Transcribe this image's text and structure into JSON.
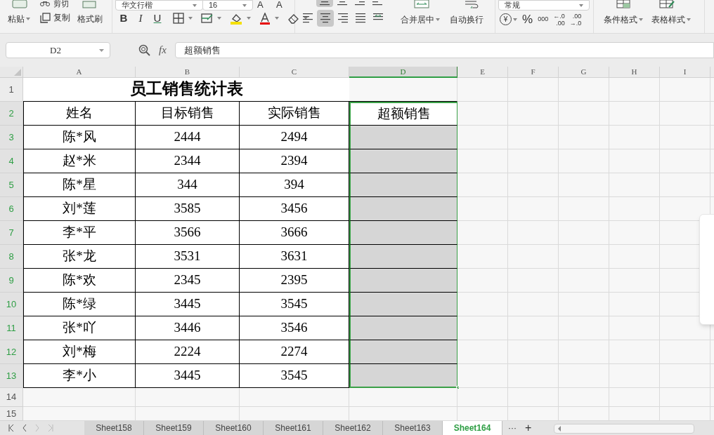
{
  "ribbon": {
    "clipboard": {
      "cut": "剪切",
      "paste": "粘贴",
      "copy": "复制",
      "format_painter": "格式刷"
    },
    "font": {
      "name": "华文行楷",
      "size": "16",
      "size_buttons": [
        "A",
        "A"
      ],
      "style_buttons": [
        "B",
        "I",
        "U"
      ]
    },
    "alignment": {
      "top_row": [
        {
          "kind": "align-middle",
          "selected": true
        },
        {
          "kind": "align-bottom",
          "selected": false
        },
        {
          "kind": "indent-less",
          "selected": false
        },
        {
          "kind": "indent-more",
          "selected": false
        }
      ],
      "bottom_row": [
        {
          "kind": "align-left",
          "selected": false
        },
        {
          "kind": "align-center",
          "selected": true
        },
        {
          "kind": "align-right",
          "selected": false
        },
        {
          "kind": "justify",
          "selected": false
        },
        {
          "kind": "distribute",
          "selected": false
        }
      ],
      "merge": "合并居中",
      "wrap": "自动换行"
    },
    "number": {
      "format": "常规",
      "currency": "¥",
      "percent": "%",
      "thousands": "000",
      "decimals": [
        {
          "top": "←.0",
          "bottom": ".00"
        },
        {
          "top": ".00",
          "bottom": "→.0"
        }
      ]
    },
    "styles": [
      "条件格式",
      "表格样式"
    ]
  },
  "formula_bar": {
    "cell_ref": "D2",
    "fx": "fx",
    "formula": "超额销售"
  },
  "column_headers": [
    {
      "label": "A",
      "selected": false
    },
    {
      "label": "B",
      "selected": false
    },
    {
      "label": "C",
      "selected": false
    },
    {
      "label": "D",
      "selected": true
    },
    {
      "label": "E",
      "selected": false
    },
    {
      "label": "F",
      "selected": false
    },
    {
      "label": "G",
      "selected": false
    },
    {
      "label": "H",
      "selected": false
    },
    {
      "label": "I",
      "selected": false
    }
  ],
  "row_headers": [
    {
      "label": "1",
      "selected": false
    },
    {
      "label": "2",
      "selected": true
    },
    {
      "label": "3",
      "selected": true
    },
    {
      "label": "4",
      "selected": true
    },
    {
      "label": "5",
      "selected": true
    },
    {
      "label": "6",
      "selected": true
    },
    {
      "label": "7",
      "selected": true
    },
    {
      "label": "8",
      "selected": true
    },
    {
      "label": "9",
      "selected": true
    },
    {
      "label": "10",
      "selected": true
    },
    {
      "label": "11",
      "selected": true
    },
    {
      "label": "12",
      "selected": true
    },
    {
      "label": "13",
      "selected": true
    },
    {
      "label": "14",
      "selected": false
    },
    {
      "label": "15",
      "selected": false
    }
  ],
  "sheet": {
    "title": "员工销售统计表",
    "columns": [
      "姓名",
      "目标销售",
      "实际销售",
      "超额销售"
    ],
    "rows": [
      [
        "陈*风",
        "2444",
        "2494"
      ],
      [
        "赵*米",
        "2344",
        "2394"
      ],
      [
        "陈*星",
        "344",
        "394"
      ],
      [
        "刘*莲",
        "3585",
        "3456"
      ],
      [
        "李*平",
        "3566",
        "3666"
      ],
      [
        "张*龙",
        "3531",
        "3631"
      ],
      [
        "陈*欢",
        "2345",
        "2395"
      ],
      [
        "陈*绿",
        "3445",
        "3545"
      ],
      [
        "张*吖",
        "3446",
        "3546"
      ],
      [
        "刘*梅",
        "2224",
        "2274"
      ],
      [
        "李*小",
        "3445",
        "3545"
      ]
    ]
  },
  "sheet_tabs": [
    {
      "label": "Sheet158",
      "selected": false
    },
    {
      "label": "Sheet159",
      "selected": false
    },
    {
      "label": "Sheet160",
      "selected": false
    },
    {
      "label": "Sheet161",
      "selected": false
    },
    {
      "label": "Sheet162",
      "selected": false
    },
    {
      "label": "Sheet163",
      "selected": false
    },
    {
      "label": "Sheet164",
      "selected": true
    }
  ],
  "tab_more": "···",
  "tab_add": "+"
}
